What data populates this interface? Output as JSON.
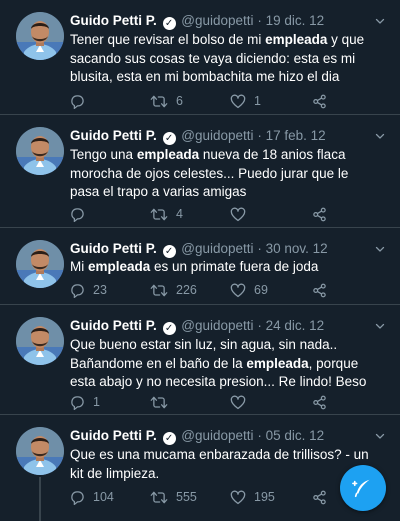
{
  "user": {
    "name": "Guido Petti P.",
    "handle": "@guidopetti"
  },
  "tweets": [
    {
      "date": "19 dic. 12",
      "before": "Tener que revisar el bolso de mi ",
      "highlight": "empleada",
      "after": " y que sacando sus cosas te vaya diciendo: esta es mi blusita, esta en mi bombachita me hizo el dia",
      "reply_count": "",
      "retweet_count": "6",
      "like_count": "1"
    },
    {
      "date": "17 feb. 12",
      "before": "Tengo una ",
      "highlight": "empleada",
      "after": " nueva de 18 anios flaca morocha de ojos celestes... Puedo jurar que le pasa el trapo a varias amigas",
      "reply_count": "",
      "retweet_count": "4",
      "like_count": ""
    },
    {
      "date": "30 nov. 12",
      "before": "Mi ",
      "highlight": "empleada",
      "after": " es un primate fuera de joda",
      "reply_count": "23",
      "retweet_count": "226",
      "like_count": "69"
    },
    {
      "date": "24 dic. 12",
      "before": "Que bueno estar sin luz, sin agua, sin nada.. Bañandome en el baño de la ",
      "highlight": "empleada",
      "after": ", porque esta abajo y no necesita presion... Re lindo! Beso",
      "reply_count": "1",
      "retweet_count": "",
      "like_count": ""
    },
    {
      "date": "05 dic. 12",
      "before": "Que es una mucama enbarazada de trillisos? - un kit de limpieza.",
      "highlight": "",
      "after": "",
      "reply_count": "104",
      "retweet_count": "555",
      "like_count": "195"
    }
  ],
  "icons": {
    "reply": "reply-icon",
    "retweet": "retweet-icon",
    "like": "heart-icon",
    "share": "share-icon",
    "compose": "compose-tweet-icon",
    "verified": "verified-badge-icon",
    "caret": "chevron-down-icon"
  },
  "colors": {
    "background": "#15202b",
    "muted": "#8899a6",
    "divider": "#38444d",
    "accent": "#1da1f2"
  },
  "separator": "·"
}
